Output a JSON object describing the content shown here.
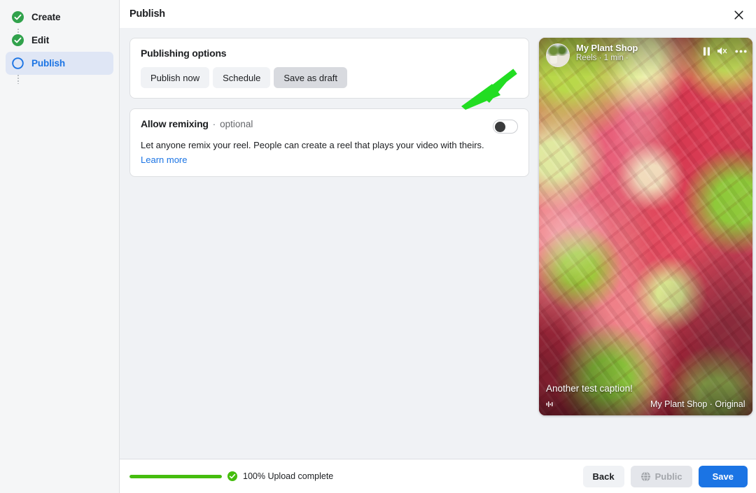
{
  "sidebar": {
    "items": [
      {
        "label": "Create",
        "state": "complete",
        "icon": "check-circle-icon"
      },
      {
        "label": "Edit",
        "state": "complete",
        "icon": "check-circle-icon"
      },
      {
        "label": "Publish",
        "state": "active",
        "icon": "circle-outline-icon"
      }
    ]
  },
  "header": {
    "title": "Publish",
    "close_icon": "close-icon"
  },
  "publishing_options": {
    "title": "Publishing options",
    "buttons": [
      {
        "label": "Publish now",
        "selected": false
      },
      {
        "label": "Schedule",
        "selected": false
      },
      {
        "label": "Save as draft",
        "selected": true
      }
    ]
  },
  "allow_remixing": {
    "title": "Allow remixing",
    "separator": "·",
    "optional_label": "optional",
    "description": "Let anyone remix your reel. People can create a reel that plays your video with theirs.",
    "link_label": "Learn more",
    "toggle_state": "off"
  },
  "preview": {
    "account_name": "My Plant Shop",
    "meta": "Reels · 1 min ·",
    "caption": "Another test caption!",
    "audio_ticker": "My Plant Shop · Original audio",
    "controls": [
      {
        "name": "pause-icon"
      },
      {
        "name": "volume-muted-icon"
      },
      {
        "name": "more-options-icon"
      }
    ],
    "music_icon": "music-note-icon",
    "avatar_icon": "avatar"
  },
  "footer": {
    "progress_percent": 100,
    "progress_bar_value": "100%",
    "status_text": "100% Upload complete",
    "status_icon": "check-circle-icon",
    "back_label": "Back",
    "audience_label": "Public",
    "audience_icon": "globe-icon",
    "save_label": "Save"
  },
  "annotation": {
    "type": "arrow",
    "points_to": "Save as draft",
    "color": "#22dd22"
  },
  "colors": {
    "accent_blue": "#1b74e4",
    "success_green": "#45bd0e",
    "page_bg": "#f0f2f5",
    "card_bg": "#ffffff",
    "sidebar_bg": "#f5f6f7",
    "selected_btn": "#d8dadf",
    "annotation_green": "#22dd22"
  }
}
